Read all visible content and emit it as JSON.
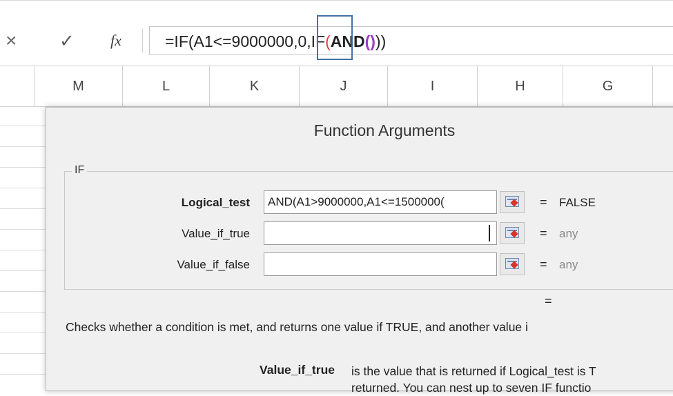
{
  "formula_bar": {
    "cancel_icon": "×",
    "enter_icon": "✓",
    "fx_label": "fx",
    "formula_parts": {
      "p1": "=IF(A1<=9000000,0,IF",
      "p2": "(",
      "p3": "AND",
      "p4": "()",
      "p5": "))"
    }
  },
  "columns": [
    "M",
    "L",
    "K",
    "J",
    "I",
    "H",
    "G"
  ],
  "dialog": {
    "title": "Function Arguments",
    "group_label": "IF",
    "arguments": [
      {
        "label": "Logical_test",
        "value": "AND(A1>9000000,A1<=1500000(",
        "result": "FALSE"
      },
      {
        "label": "Value_if_true",
        "value": "",
        "result": "any"
      },
      {
        "label": "Value_if_false",
        "value": "",
        "result": "any"
      }
    ],
    "equals": "=",
    "formula_result_equals": "=",
    "description": "Checks whether a condition is met, and returns one value if TRUE, and another value i",
    "help": {
      "label": "Value_if_true",
      "lines": [
        "is the value that is returned if Logical_test is T",
        "returned. You can nest up to seven IF functio"
      ]
    }
  },
  "colors": {
    "paren_red": "#e63b3b",
    "paren_purple": "#9b3cc5",
    "highlight_box": "#4472a8",
    "dialog_bg": "#f0f0f0"
  },
  "icons": [
    "cancel-icon",
    "enter-check-icon",
    "fx-icon",
    "ref-edit-icon"
  ]
}
